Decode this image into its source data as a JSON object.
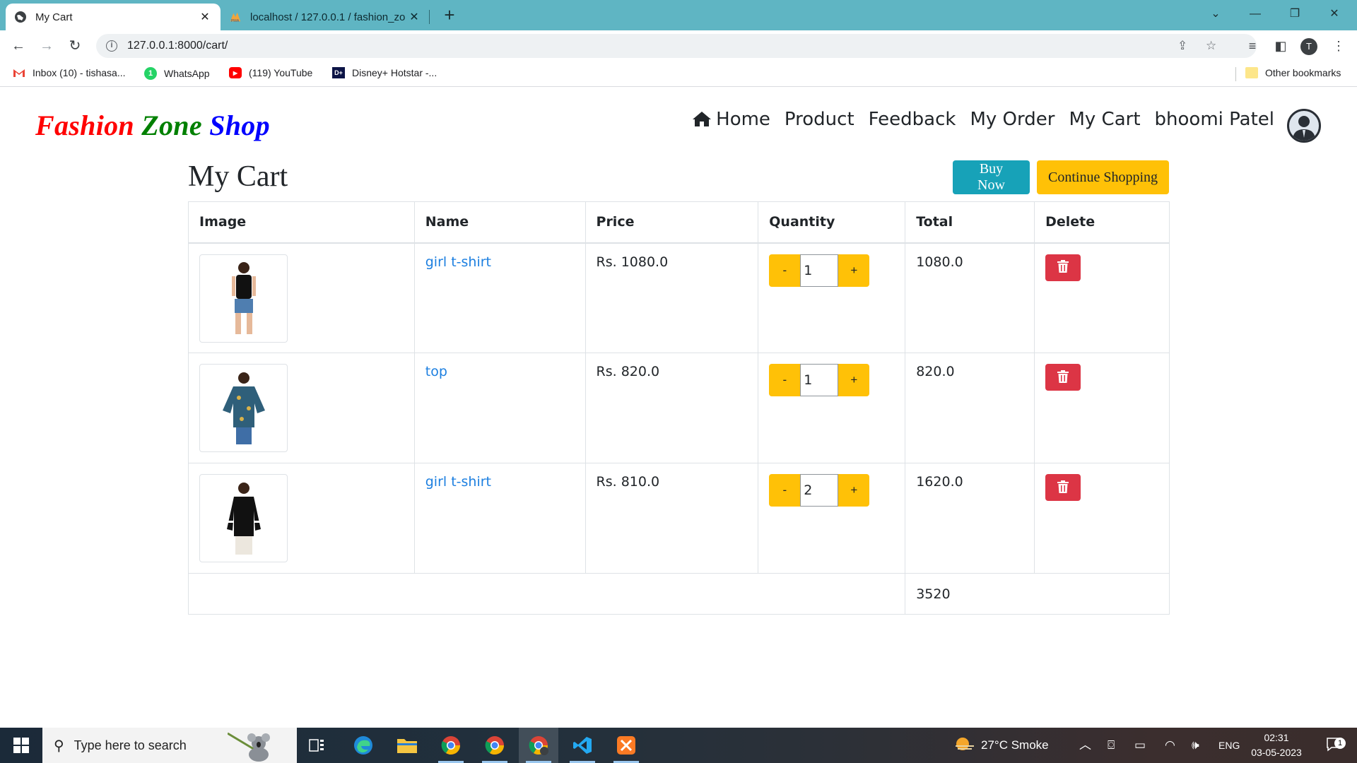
{
  "browser": {
    "tabs": [
      {
        "title": "My Cart",
        "active": true
      },
      {
        "title": "localhost / 127.0.0.1 / fashion_zo",
        "active": false
      }
    ],
    "new_tab": "+",
    "url": "127.0.0.1:8000/cart/",
    "profile_initial": "T",
    "bookmarks": [
      {
        "label": "Inbox (10) - tishasa...",
        "icon": "gmail-icon"
      },
      {
        "label": "WhatsApp",
        "icon": "whatsapp-icon"
      },
      {
        "label": "(119) YouTube",
        "icon": "youtube-icon"
      },
      {
        "label": "Disney+ Hotstar -...",
        "icon": "hotstar-icon"
      }
    ],
    "other_bookmarks": "Other bookmarks"
  },
  "site": {
    "brand": {
      "word1": "Fashion",
      "word2": "Zone",
      "word3": "Shop"
    },
    "nav": [
      "Home",
      "Product",
      "Feedback",
      "My Order",
      "My Cart",
      "bhoomi Patel"
    ]
  },
  "cart": {
    "title": "My Cart",
    "buy_now": "Buy Now",
    "continue_shopping": "Continue Shopping",
    "columns": [
      "Image",
      "Name",
      "Price",
      "Quantity",
      "Total",
      "Delete"
    ],
    "items": [
      {
        "name": "girl t-shirt",
        "price": "Rs. 1080.0",
        "quantity": "1",
        "total": "1080.0"
      },
      {
        "name": "top",
        "price": "Rs. 820.0",
        "quantity": "1",
        "total": "820.0"
      },
      {
        "name": "girl t-shirt",
        "price": "Rs. 810.0",
        "quantity": "2",
        "total": "1620.0"
      }
    ],
    "minus_label": "-",
    "plus_label": "+",
    "grand_total": "3520"
  },
  "taskbar": {
    "search_placeholder": "Type here to search",
    "weather": "27°C  Smoke",
    "language": "ENG",
    "time": "02:31",
    "date": "03-05-2023",
    "notification_count": "1"
  }
}
